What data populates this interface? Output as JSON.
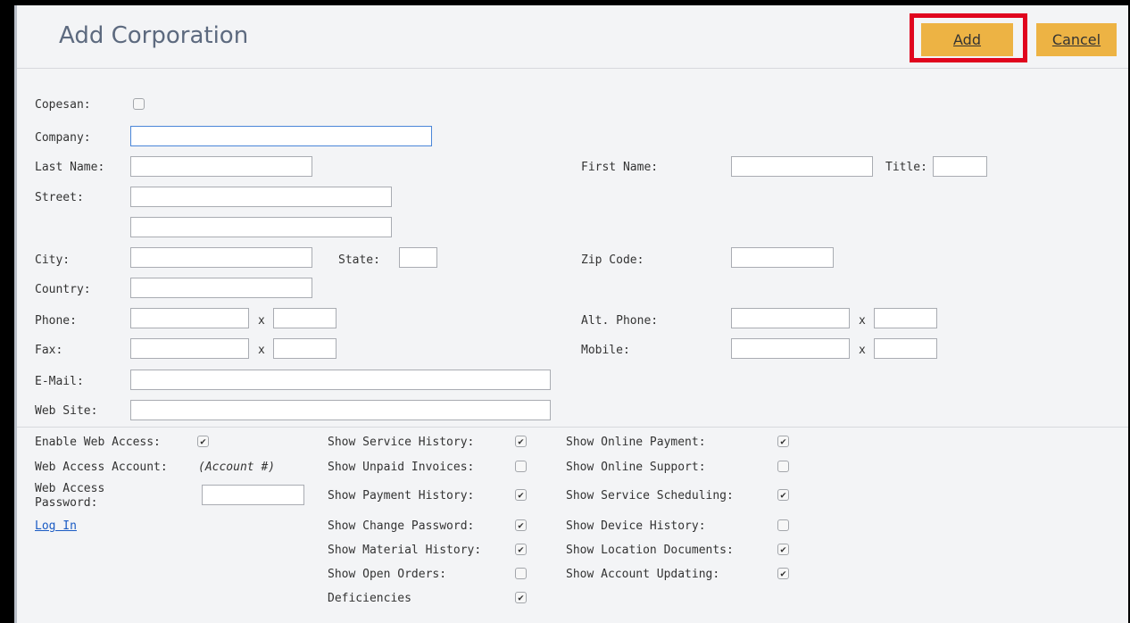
{
  "header": {
    "title": "Add Corporation",
    "add_label": "Add",
    "cancel_label": "Cancel"
  },
  "form": {
    "copesan": "Copesan:",
    "company": "Company:",
    "last_name": "Last Name:",
    "first_name": "First Name:",
    "title": "Title:",
    "street": "Street:",
    "city": "City:",
    "state": "State:",
    "zip": "Zip Code:",
    "country": "Country:",
    "phone": "Phone:",
    "alt_phone": "Alt. Phone:",
    "fax": "Fax:",
    "mobile": "Mobile:",
    "email": "E-Mail:",
    "website": "Web Site:",
    "ext": "x"
  },
  "web": {
    "enable": "Enable Web Access:",
    "account": "Web Access Account:",
    "account_value": "(Account #)",
    "password": "Web Access Password:",
    "login": "Log In"
  },
  "options_col1": [
    {
      "label": "Show Service History:",
      "checked": true
    },
    {
      "label": "Show Unpaid Invoices:",
      "checked": false
    },
    {
      "label": "Show Payment History:",
      "checked": true
    },
    {
      "label": "Show Change Password:",
      "checked": true
    },
    {
      "label": "Show Material History:",
      "checked": true
    },
    {
      "label": "Show Open Orders:",
      "checked": false
    },
    {
      "label": "Deficiencies",
      "checked": true
    }
  ],
  "options_col2": [
    {
      "label": "Show Online Payment:",
      "checked": true
    },
    {
      "label": "Show Online Support:",
      "checked": false
    },
    {
      "label": "Show Service Scheduling:",
      "checked": true
    },
    {
      "label": "Show Device History:",
      "checked": false
    },
    {
      "label": "Show Location Documents:",
      "checked": true
    },
    {
      "label": "Show Account Updating:",
      "checked": true
    }
  ],
  "colors": {
    "accent": "#edb344",
    "highlight": "#e0051e",
    "title": "#5d6a7f"
  }
}
